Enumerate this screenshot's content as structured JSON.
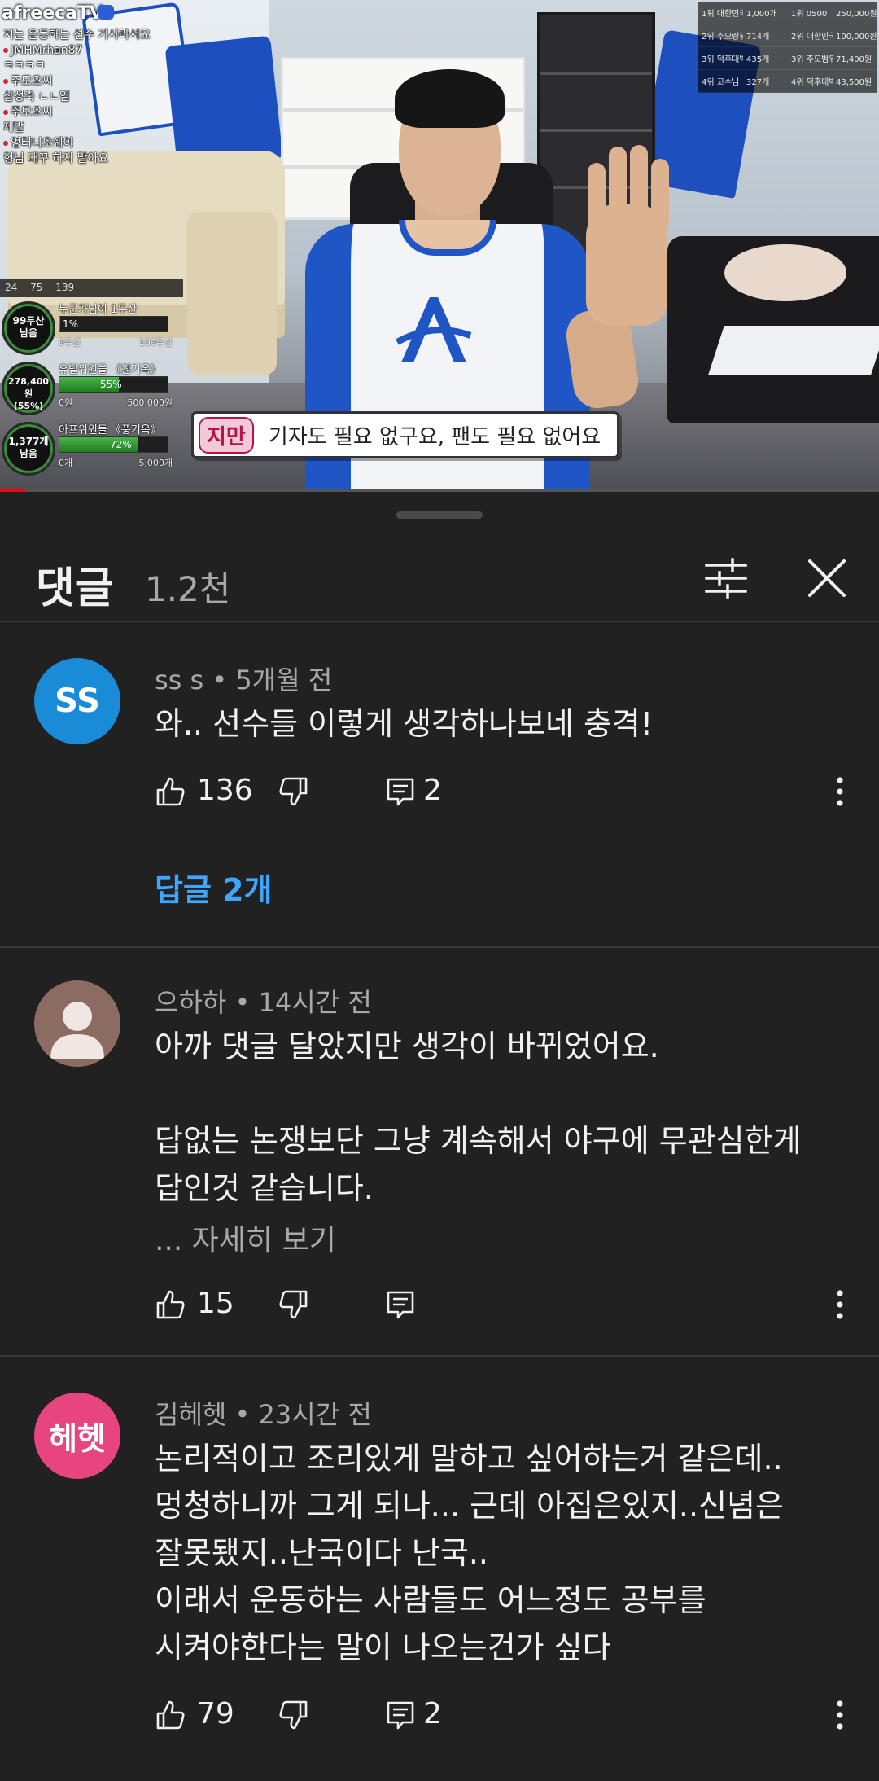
{
  "video": {
    "brand": "afreecaTV",
    "chat": [
      "저는 운동하는 선수 기사라서요",
      "JMHMrhan87",
      "ㅋㅋㅋㅋ",
      "주모오씨",
      "삼성축 ㄴㄴ임",
      "주모오씨",
      "제발",
      "엉터니오쉐이",
      "형님 대꾸 하지 말아요"
    ],
    "stats": [
      "24",
      "75",
      "139"
    ],
    "goals": [
      {
        "circle": "99두산\n남음",
        "title": "누군가님이 1두산",
        "fill": 0.01,
        "pct": "1%",
        "left": "0두산",
        "right": "100두산"
      },
      {
        "circle": "278,400원\n(55%)",
        "title": "유틸위원들 《원기옥》",
        "fill": 0.55,
        "pct": "55%",
        "left": "0원",
        "right": "500,000원"
      },
      {
        "circle": "1,377개\n남음",
        "title": "아프위원들 《풍기옥》",
        "fill": 0.72,
        "pct": "72%",
        "left": "0개",
        "right": "5,000개"
      }
    ],
    "rank": [
      [
        "1위 대한민국",
        "1,000개",
        "1위 0500",
        "250,000원"
      ],
      [
        "2위 주모랑위",
        "714개",
        "2위 대한민국",
        "100,000원"
      ],
      [
        "3위 덕후대박",
        "435개",
        "3위 주모범위",
        "71,400원"
      ],
      [
        "4위 고수님",
        "327개",
        "4위 덕후대박",
        "43,500원"
      ]
    ],
    "subtitle_speaker": "지만",
    "subtitle_text": "기자도 필요 없구요, 팬도 필요 없어요",
    "progress": 0.03
  },
  "comments_panel": {
    "title": "댓글",
    "count": "1.2천",
    "filter_icon": "sliders-icon",
    "close_icon": "close-icon"
  },
  "comments": [
    {
      "avatar_text": "SS",
      "avatar_color": "#1a8bd6",
      "author": "ss s",
      "time": "5개월 전",
      "text": "와.. 선수들 이렇게 생각하나보네 충격!",
      "likes": "136",
      "replies_count": "2",
      "replies_label": "답글 2개"
    },
    {
      "avatar_text": "",
      "avatar_color": "#8c6b63",
      "author": "으하하",
      "time": "14시간 전",
      "text": "아까 댓글 달았지만 생각이 바뀌었어요.\n\n답없는 논쟁보단 그냥 계속해서 야구에 무관심한게\n답인것 같습니다.",
      "more": "... 자세히 보기",
      "likes": "15",
      "replies_count": ""
    },
    {
      "avatar_text": "헤헷",
      "avatar_color": "#e6457f",
      "author": "김헤헷",
      "time": "23시간 전",
      "text": "논리적이고 조리있게 말하고 싶어하는거 같은데..\n멍청하니까 그게 되나... 근데 아집은있지..신념은\n잘못됐지..난국이다 난국..\n이래서 운동하는 사람들도 어느정도 공부를\n시켜야한다는 말이 나오는건가 싶다",
      "likes": "79",
      "replies_count": "2"
    }
  ],
  "separator": "•"
}
